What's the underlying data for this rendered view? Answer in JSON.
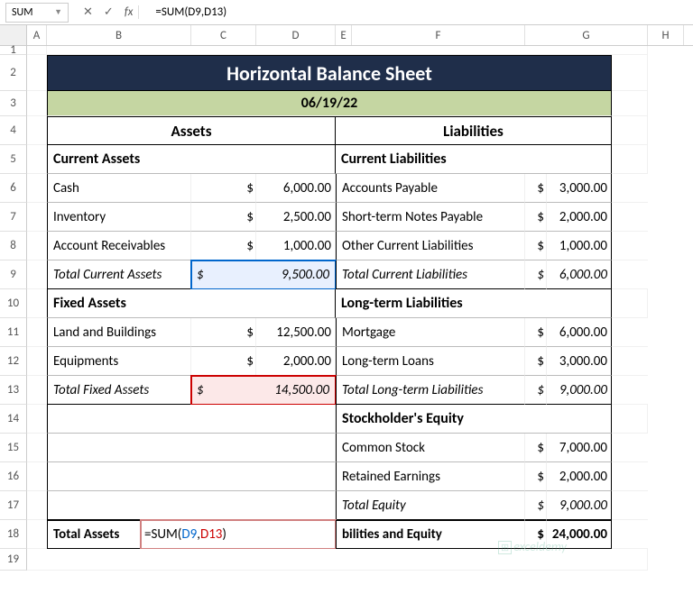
{
  "name_box": "SUM",
  "formula": "=SUM(D9,D13)",
  "columns": [
    "A",
    "B",
    "C",
    "D",
    "E",
    "F",
    "G",
    "H"
  ],
  "rows": [
    "1",
    "2",
    "3",
    "4",
    "5",
    "6",
    "7",
    "8",
    "9",
    "10",
    "11",
    "12",
    "13",
    "14",
    "15",
    "16",
    "17",
    "18",
    "19"
  ],
  "title": "Horizontal Balance Sheet",
  "date": "06/19/22",
  "assets_header": "Assets",
  "liabilities_header": "Liabilities",
  "current_assets": "Current Assets",
  "current_liabilities": "Current Liabilities",
  "r6": {
    "a": "Cash",
    "av": "6,000.00",
    "l": "Accounts Payable",
    "lv": "3,000.00"
  },
  "r7": {
    "a": "Inventory",
    "av": "2,500.00",
    "l": "Short-term Notes Payable",
    "lv": "2,000.00"
  },
  "r8": {
    "a": "Account Receivables",
    "av": "1,000.00",
    "l": "Other Current Liabilities",
    "lv": "1,000.00"
  },
  "r9": {
    "a": "Total Current Assets",
    "av": "9,500.00",
    "l": "Total Current Liabilities",
    "lv": "6,000.00"
  },
  "fixed_assets": "Fixed Assets",
  "longterm": "Long-term Liabilities",
  "r11": {
    "a": "Land and Buildings",
    "av": "12,500.00",
    "l": "Mortgage",
    "lv": "6,000.00"
  },
  "r12": {
    "a": "Equipments",
    "av": "2,000.00",
    "l": "Long-term Loans",
    "lv": "3,000.00"
  },
  "r13": {
    "a": "Total Fixed Assets",
    "av": "14,500.00",
    "l": "Total Long-term Liabilities",
    "lv": "9,000.00"
  },
  "equity": "Stockholder's Equity",
  "r15": {
    "l": "Common Stock",
    "lv": "7,000.00"
  },
  "r16": {
    "l": "Retained Earnings",
    "lv": "2,000.00"
  },
  "r17": {
    "l": "Total Equity",
    "lv": "9,000.00"
  },
  "r18": {
    "a": "Total Assets",
    "l": "bilities and Equity",
    "lv": "24,000.00"
  },
  "dollar": "$",
  "fn": "=SUM(",
  "arg1": "D9",
  "comma": ",",
  "arg2": "D13",
  "close": ")",
  "watermark": "exceldemy"
}
